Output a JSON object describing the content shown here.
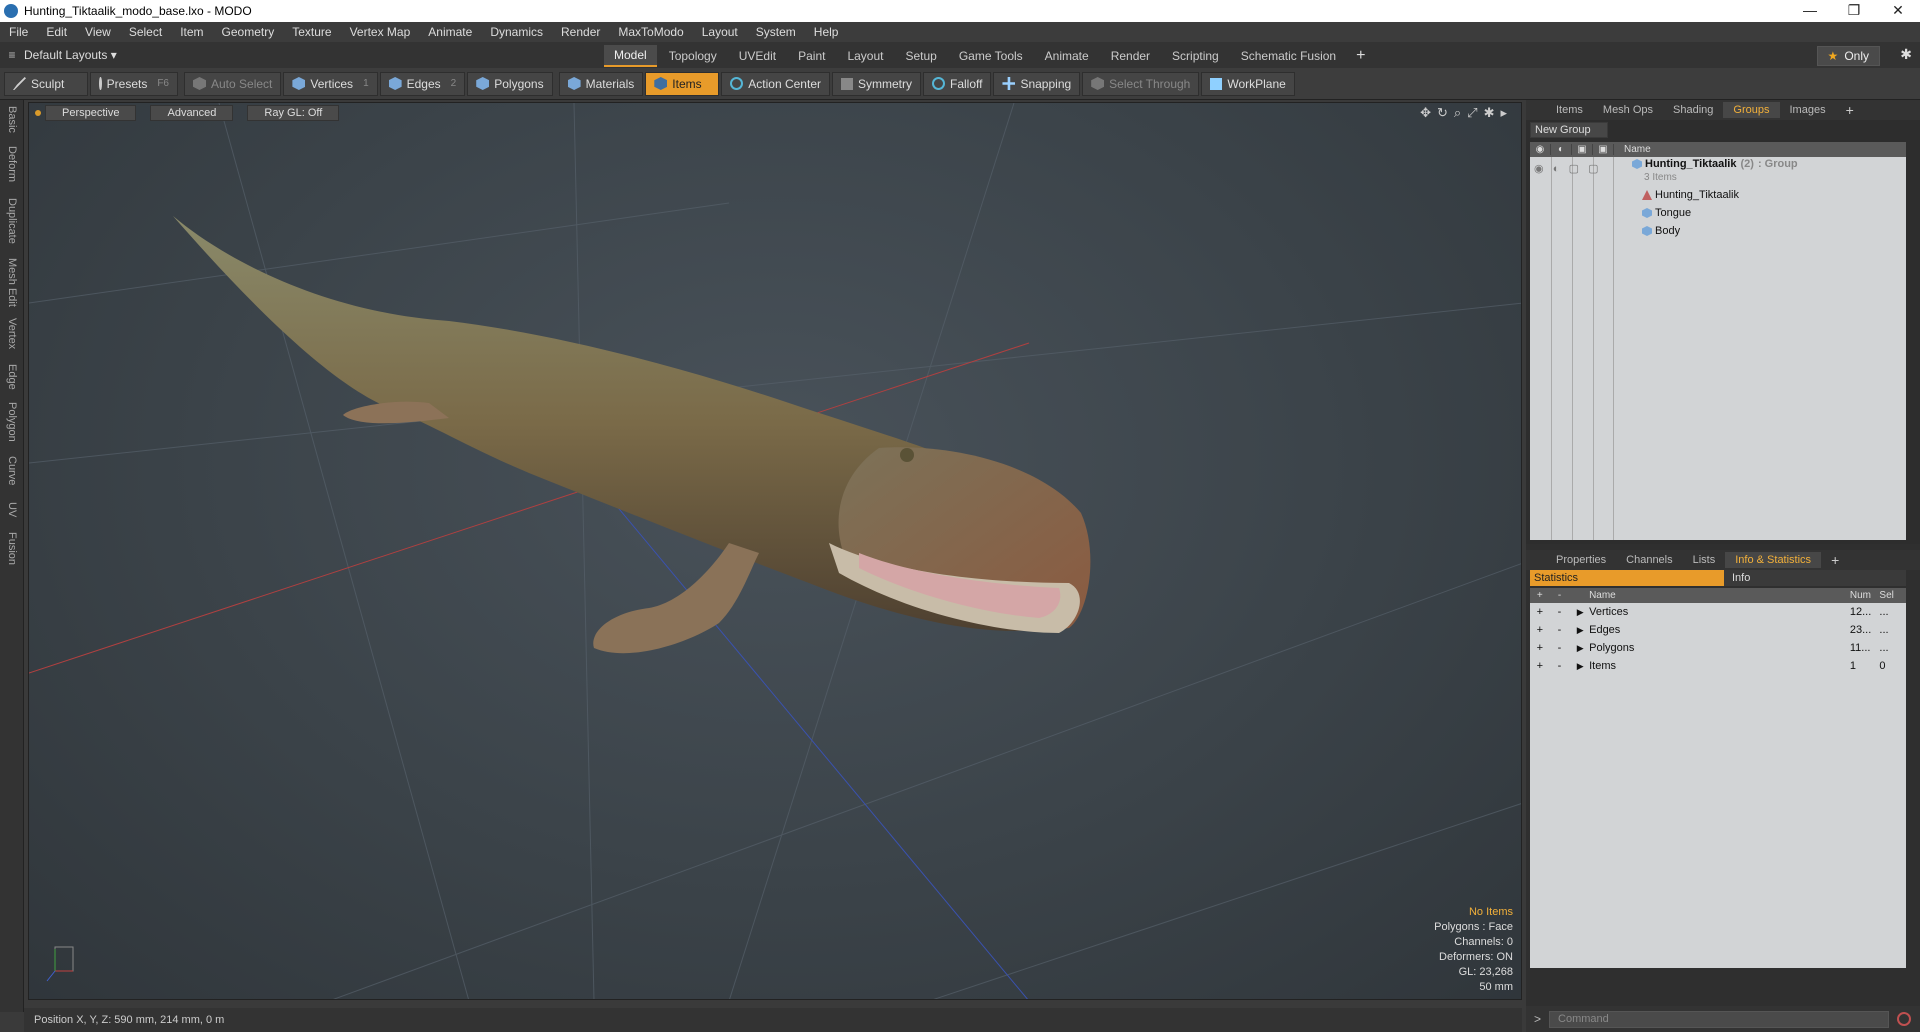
{
  "window": {
    "title": "Hunting_Tiktaalik_modo_base.lxo - MODO",
    "controls": [
      "—",
      "❐",
      "✕"
    ]
  },
  "menu": [
    "File",
    "Edit",
    "View",
    "Select",
    "Item",
    "Geometry",
    "Texture",
    "Vertex Map",
    "Animate",
    "Dynamics",
    "Render",
    "MaxToModo",
    "Layout",
    "System",
    "Help"
  ],
  "layout": {
    "default_label": "Default Layouts ▾",
    "tabs": [
      "Model",
      "Topology",
      "UVEdit",
      "Paint",
      "Layout",
      "Setup",
      "Game Tools",
      "Animate",
      "Render",
      "Scripting",
      "Schematic Fusion"
    ],
    "active_tab": "Model",
    "only_label": "Only"
  },
  "toolbar": {
    "sculpt": "Sculpt",
    "presets": "Presets",
    "presets_key": "F6",
    "auto_select": "Auto Select",
    "vertices": "Vertices",
    "vertices_key": "1",
    "edges": "Edges",
    "edges_key": "2",
    "polygons": "Polygons",
    "materials": "Materials",
    "items": "Items",
    "action_center": "Action Center",
    "symmetry": "Symmetry",
    "falloff": "Falloff",
    "snapping": "Snapping",
    "select_through": "Select Through",
    "workplane": "WorkPlane"
  },
  "left_strip": [
    "Basic",
    "Deform",
    "Duplicate",
    "Mesh Edit",
    "Vertex",
    "Edge",
    "Polygon",
    "Curve",
    "UV",
    "Fusion"
  ],
  "viewport": {
    "view": "Perspective",
    "shading": "Advanced",
    "raygl": "Ray GL: Off",
    "stats": {
      "line1": "No Items",
      "line2": "Polygons : Face",
      "line3": "Channels: 0",
      "line4": "Deformers: ON",
      "line5": "GL: 23,268",
      "line6": "50 mm"
    }
  },
  "status": {
    "position": "Position X, Y, Z:  590 mm, 214 mm, 0 m"
  },
  "groups_panel": {
    "tabs": [
      "Items",
      "Mesh Ops",
      "Shading",
      "Groups",
      "Images"
    ],
    "active_tab": "Groups",
    "new_group": "New Group",
    "name_header": "Name",
    "group_name": "Hunting_Tiktaalik",
    "group_count": "(2)",
    "group_type": ": Group",
    "group_items": "3 Items",
    "children": [
      "Hunting_Tiktaalik",
      "Tongue",
      "Body"
    ]
  },
  "props_panel": {
    "tabs": [
      "Properties",
      "Channels",
      "Lists",
      "Info & Statistics"
    ],
    "active_tab": "Info & Statistics",
    "statistics_label": "Statistics",
    "info_label": "Info",
    "headers": {
      "name": "Name",
      "num": "Num",
      "sel": "Sel"
    },
    "rows": [
      {
        "name": "Vertices",
        "num": "12...",
        "sel": "..."
      },
      {
        "name": "Edges",
        "num": "23...",
        "sel": "..."
      },
      {
        "name": "Polygons",
        "num": "11...",
        "sel": "..."
      },
      {
        "name": "Items",
        "num": "1",
        "sel": "0"
      }
    ]
  },
  "command": {
    "placeholder": "Command",
    "prompt": ">"
  }
}
